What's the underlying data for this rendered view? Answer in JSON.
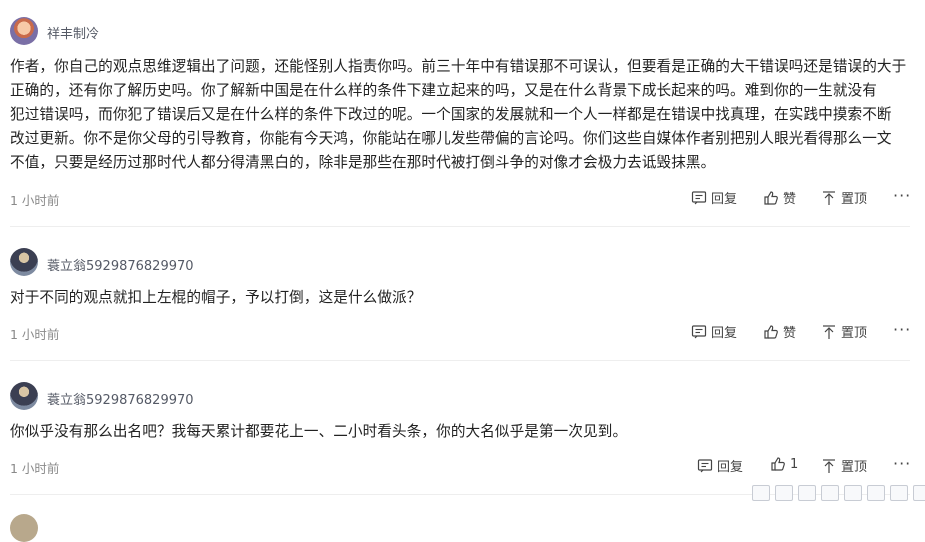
{
  "comments": [
    {
      "author": "祥丰制冷",
      "text_lines": [
        "作者，你自己的观点思维逻辑出了问题，还能怪别人指责你吗。前三十年中有错误那不可误认，但要看是正确的大干错误吗还是错误的大于",
        "正确的，还有你了解历史吗。你了解新中国是在什么样的条件下建立起来的吗，又是在什么背景下成长起来的吗。难到你的一生就没有",
        "犯过错误吗，而你犯了错误后又是在什么样的条件下改过的呢。一个国家的发展就和一个人一样都是在错误中找真理，在实践中摸索不断",
        "改过更新。你不是你父母的引导教育，你能有今天鸿，你能站在哪儿发些帶偏的言论吗。你们这些自媒体作者别把别人眼光看得那么一文",
        "不值，只要是经历过那时代人都分得清黑白的，除非是那些在那时代被打倒斗争的对像才会极力去诋毁抹黑。"
      ],
      "time": "1 小时前",
      "reply": "回复",
      "like": "赞",
      "pin": "置顶",
      "more": "···"
    },
    {
      "author": "蓑立翁5929876829970",
      "text_lines": [
        "对于不同的观点就扣上左棍的帽子，予以打倒，这是什么做派？"
      ],
      "time": "1 小时前",
      "reply": "回复",
      "like": "赞",
      "pin": "置顶",
      "more": "···"
    },
    {
      "author": "蓑立翁5929876829970",
      "text_lines": [
        "你似乎没有那么出名吧？我每天累计都要花上一、二小时看头条，你的大名似乎是第一次见到。"
      ],
      "time": "1 小时前",
      "reply": "回复",
      "like": "1",
      "pin": "置顶",
      "more": "···"
    }
  ],
  "icons": {
    "reply": "comment-reply-icon",
    "like": "thumbs-up-icon",
    "pin": "pin-to-top-icon",
    "more": "more-icon"
  }
}
